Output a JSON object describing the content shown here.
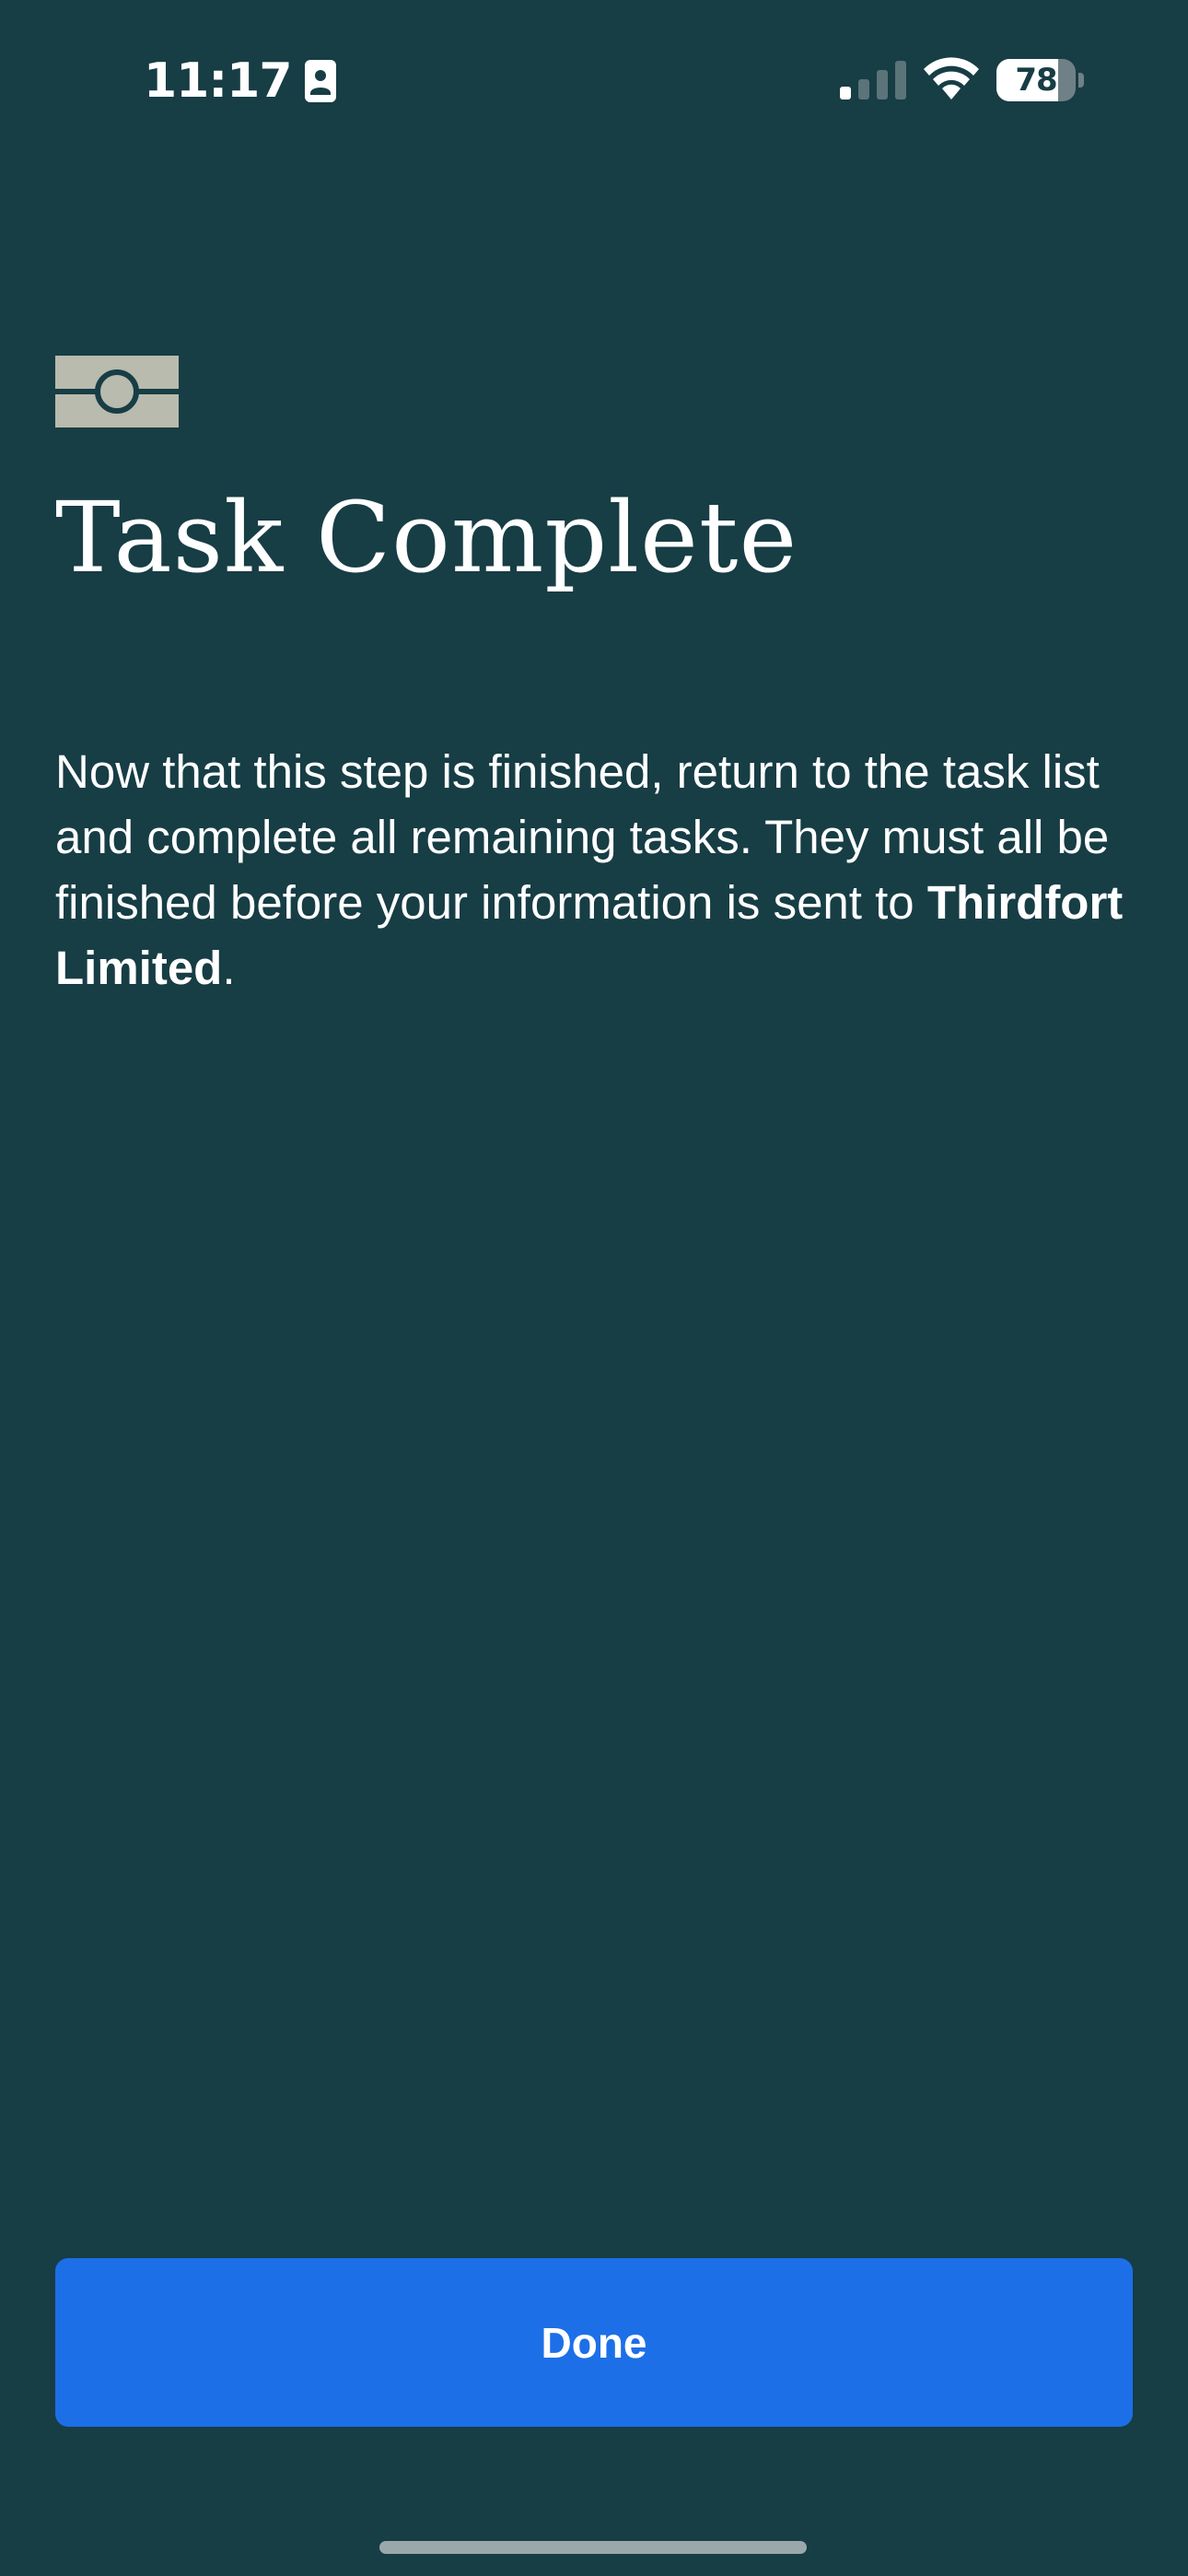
{
  "status_bar": {
    "time": "11:17",
    "battery_level": "78",
    "battery_fraction": 0.78,
    "signal_bars_active": 1,
    "signal_bars_total": 4,
    "icons": [
      "contact-card-icon",
      "cellular-signal-icon",
      "wifi-icon",
      "battery-icon"
    ]
  },
  "logo": {
    "icon": "thirdfort-logo-icon",
    "color": "#b8bbad"
  },
  "page": {
    "title": "Task Complete",
    "body_text": "Now that this step is finished, return to the task list and complete all remaining tasks. They must all be finished before your information is sent to ",
    "company_name": "Thirdfort Limited",
    "body_suffix": "."
  },
  "actions": {
    "done_label": "Done"
  },
  "colors": {
    "background": "#173d45",
    "primary_button": "#1d6fe8",
    "text": "#ffffff"
  }
}
